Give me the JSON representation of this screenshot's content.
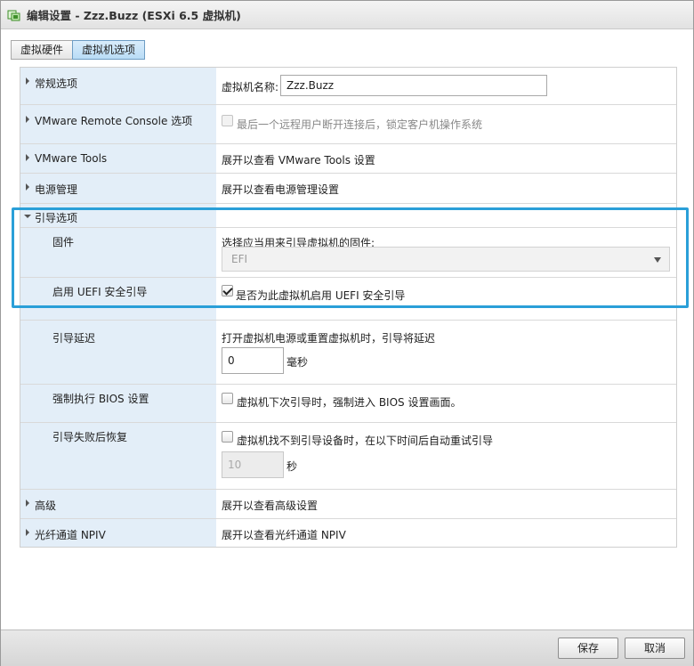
{
  "window": {
    "title": "编辑设置 - Zzz.Buzz (ESXi 6.5 虚拟机)"
  },
  "tabs": [
    {
      "label": "虚拟硬件",
      "active": false
    },
    {
      "label": "虚拟机选项",
      "active": true
    }
  ],
  "rows": {
    "general": {
      "label": "常规选项",
      "name_label": "虚拟机名称:",
      "name_value": "Zzz.Buzz"
    },
    "vmrc": {
      "label": "VMware Remote Console 选项",
      "checkbox_label": "最后一个远程用户断开连接后，锁定客户机操作系统"
    },
    "tools": {
      "label": "VMware Tools",
      "value": "展开以查看 VMware Tools 设置"
    },
    "power": {
      "label": "电源管理",
      "value": "展开以查看电源管理设置"
    },
    "boot": {
      "label": "引导选项"
    },
    "firmware": {
      "label": "固件",
      "desc": "选择应当用来引导虚拟机的固件:",
      "selected": "EFI"
    },
    "secure_boot": {
      "label": "启用 UEFI 安全引导",
      "checkbox_label": "是否为此虚拟机启用 UEFI 安全引导",
      "checked": true
    },
    "boot_delay": {
      "label": "引导延迟",
      "desc": "打开虚拟机电源或重置虚拟机时，引导将延迟",
      "value": "0",
      "unit": "毫秒"
    },
    "force_bios": {
      "label": "强制执行 BIOS 设置",
      "checkbox_label": "虚拟机下次引导时，强制进入 BIOS 设置画面。"
    },
    "boot_retry": {
      "label": "引导失败后恢复",
      "checkbox_label": "虚拟机找不到引导设备时，在以下时间后自动重试引导",
      "value": "10",
      "unit": "秒"
    },
    "advanced": {
      "label": "高级",
      "value": "展开以查看高级设置"
    },
    "npiv": {
      "label": "光纤通道 NPIV",
      "value": "展开以查看光纤通道 NPIV"
    }
  },
  "footer": {
    "save_label": "保存",
    "cancel_label": "取消"
  },
  "colors": {
    "highlight": "#2a9fd8",
    "label_column": "#e3eef8"
  }
}
